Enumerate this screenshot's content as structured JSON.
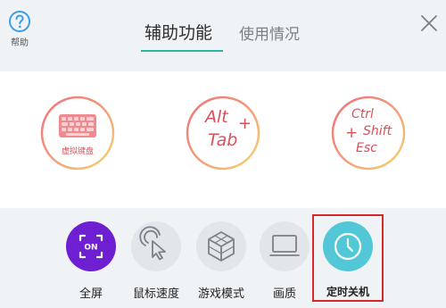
{
  "header": {
    "help_label": "帮助",
    "tabs": [
      {
        "label": "辅助功能",
        "active": true
      },
      {
        "label": "使用情况",
        "active": false
      }
    ],
    "close_icon": "close-icon",
    "help_icon": "help-icon"
  },
  "quick_keys": {
    "virtual_keyboard": {
      "label": "虚拟键盘",
      "icon": "keyboard-icon"
    },
    "alt_tab": {
      "line1": "Alt",
      "plus": "+",
      "line2": "Tab"
    },
    "ctrl_shift_esc": {
      "line1": "Ctrl",
      "plus": "+",
      "line2": "Shift",
      "line3": "Esc"
    }
  },
  "toolbar": {
    "items": [
      {
        "label": "全屏",
        "icon": "fullscreen-icon",
        "badge": "ON"
      },
      {
        "label": "鼠标速度",
        "icon": "mouse-speed-icon"
      },
      {
        "label": "游戏模式",
        "icon": "game-mode-icon"
      },
      {
        "label": "画质",
        "icon": "monitor-icon"
      },
      {
        "label": "定时关机",
        "icon": "clock-icon",
        "highlighted": true
      }
    ]
  },
  "colors": {
    "accent_underline": "#2ab5a4",
    "fullscreen_purple": "#6d1fd1",
    "clock_teal": "#52c7d7",
    "highlight_red": "#d62828",
    "key_text_red": "#d8505a"
  }
}
